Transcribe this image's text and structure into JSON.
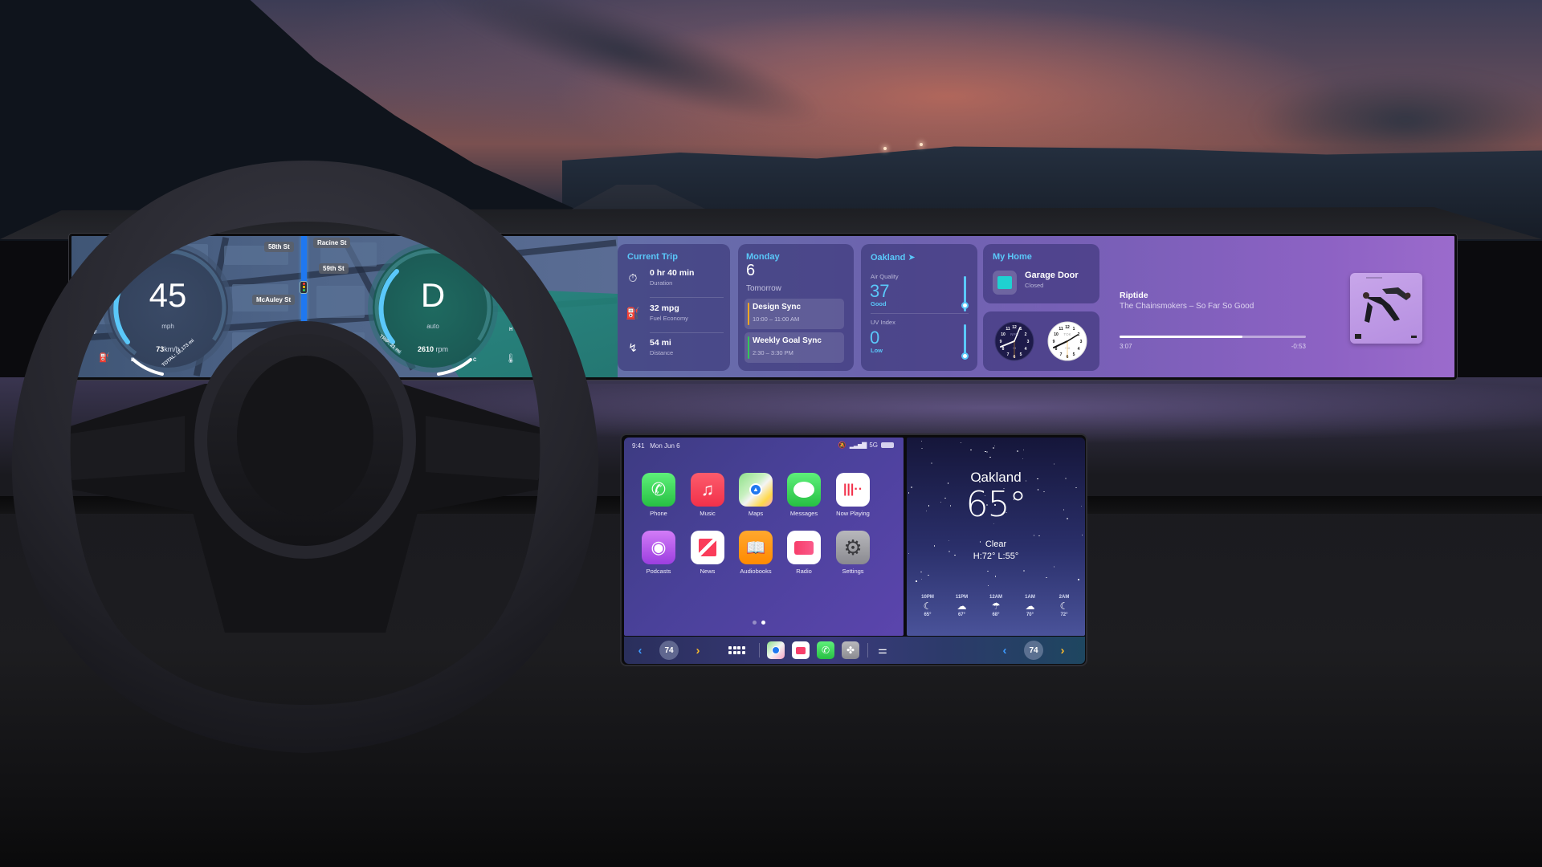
{
  "instrument_cluster": {
    "speed": "45",
    "speed_unit": "mph",
    "speed_alt": "73",
    "speed_alt_unit": "km/h",
    "gear": "D",
    "gear_mode": "auto",
    "rpm": "2610",
    "rpm_unit": "rpm",
    "odometer": "TOTAL: 12,173 mi",
    "trip_odometer": "TRIP: 21 mi",
    "fuel_gauge": {
      "full_label": "F",
      "empty_label": "E",
      "icon": "fuel-pump-icon"
    },
    "temp_gauge": {
      "hot_label": "H",
      "cold_label": "C",
      "icon": "coolant-temp-icon"
    },
    "map": {
      "street_labels": [
        "58th St",
        "Racine St",
        "59th St",
        "McAuley St"
      ]
    },
    "colors": {
      "gauge_accent": "#5ac8fa",
      "route": "#1f78f0"
    }
  },
  "widgets": {
    "current_trip": {
      "title": "Current Trip",
      "rows": [
        {
          "icon": "stopwatch-icon",
          "value": "0 hr 40 min",
          "label": "Duration"
        },
        {
          "icon": "fuel-pump-icon",
          "value": "32 mpg",
          "label": "Fuel Economy"
        },
        {
          "icon": "route-icon",
          "value": "54 mi",
          "label": "Distance"
        }
      ]
    },
    "calendar": {
      "weekday": "Monday",
      "day": "6",
      "section": "Tomorrow",
      "events": [
        {
          "title": "Design Sync",
          "time": "10:00 – 11:00 AM",
          "color": "#f5a623"
        },
        {
          "title": "Weekly Goal Sync",
          "time": "2:30 – 3:30 PM",
          "color": "#34c759"
        }
      ]
    },
    "weather": {
      "city": "Oakland",
      "location_icon": "location-arrow-icon",
      "air_quality": {
        "label": "Air Quality",
        "value": "37",
        "rating": "Good",
        "level_fraction": 0.1
      },
      "uv_index": {
        "label": "UV Index",
        "value": "0",
        "rating": "Low",
        "level_fraction": 0.0
      }
    },
    "home": {
      "title": "My Home",
      "accessory": "Garage Door",
      "status": "Closed",
      "icon": "garage-door-icon"
    },
    "world_clocks": [
      {
        "city": "NYC",
        "offset": "+3",
        "theme": "dark"
      },
      {
        "city": "TOK",
        "offset": "+16",
        "theme": "light"
      }
    ],
    "now_playing": {
      "title": "Riptide",
      "subtitle": "The Chainsmokers – So Far So Good",
      "elapsed": "3:07",
      "remaining": "-0:53",
      "progress_fraction": 0.66
    }
  },
  "carplay": {
    "status_bar": {
      "time": "9:41",
      "date": "Mon Jun 6",
      "network": "5G",
      "icons": [
        "notifications-silenced-icon",
        "signal-bars-icon",
        "battery-icon"
      ]
    },
    "apps": [
      {
        "name": "Phone",
        "icon": "phone-icon",
        "color": "#34c759"
      },
      {
        "name": "Music",
        "icon": "music-note-icon",
        "color": "#fa3c4c"
      },
      {
        "name": "Maps",
        "icon": "maps-icon",
        "color": "#7ed37a"
      },
      {
        "name": "Messages",
        "icon": "message-bubble-icon",
        "color": "#34c759"
      },
      {
        "name": "Now Playing",
        "icon": "waveform-icon",
        "color": "#ffffff"
      },
      {
        "name": "Podcasts",
        "icon": "podcasts-icon",
        "color": "#b45cf0"
      },
      {
        "name": "News",
        "icon": "news-icon",
        "color": "#ffffff"
      },
      {
        "name": "Audiobooks",
        "icon": "open-book-icon",
        "color": "#ff9500"
      },
      {
        "name": "Radio",
        "icon": "radio-icon",
        "color": "#ffffff"
      },
      {
        "name": "Settings",
        "icon": "gear-icon",
        "color": "#8e8e93"
      }
    ],
    "page_count": 2,
    "current_page": 2,
    "weather_widget": {
      "city": "Oakland",
      "temperature": "65°",
      "condition": "Clear",
      "high_low": "H:72°  L:55°",
      "hourly": [
        {
          "hour": "10PM",
          "icon": "moon-stars-icon",
          "temp": "65°"
        },
        {
          "hour": "11PM",
          "icon": "cloud-moon-rain-icon",
          "temp": "67°"
        },
        {
          "hour": "12AM",
          "icon": "cloud-rain-icon",
          "temp": "68°"
        },
        {
          "hour": "1AM",
          "icon": "cloud-moon-icon",
          "temp": "70°"
        },
        {
          "hour": "2AM",
          "icon": "moon-stars-icon",
          "temp": "72°"
        }
      ]
    },
    "dock": {
      "left_climate": {
        "temperature": "74"
      },
      "right_climate": {
        "temperature": "74"
      },
      "recent_apps": [
        "maps-icon",
        "radio-icon",
        "phone-icon",
        "climate-fan-icon"
      ],
      "app_grid_icon": "app-grid-icon",
      "controls_icon": "toggle-controls-icon"
    }
  }
}
